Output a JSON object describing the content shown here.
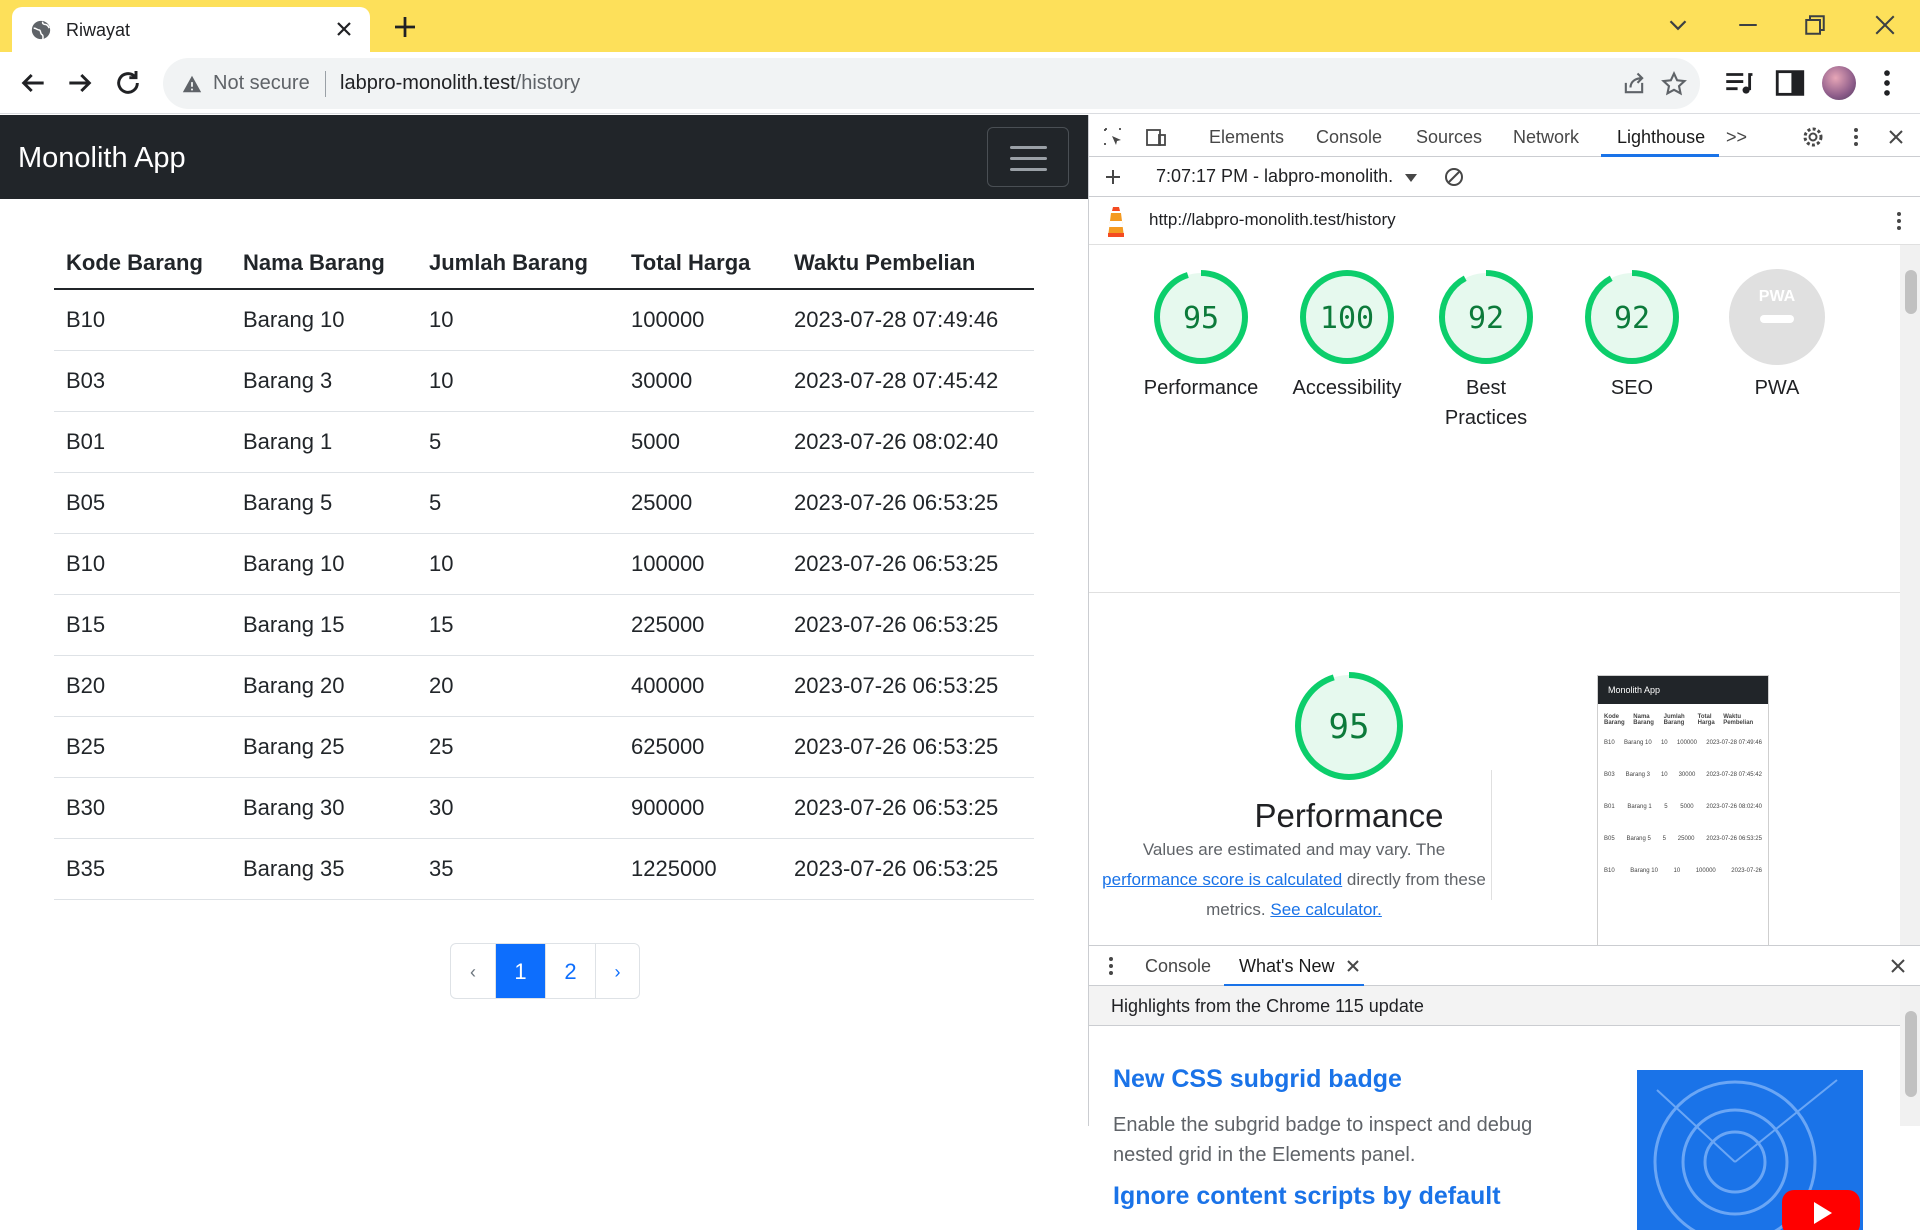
{
  "browser": {
    "tab_title": "Riwayat",
    "security_label": "Not secure",
    "url_host": "labpro-monolith.test",
    "url_path": "/history"
  },
  "app": {
    "brand": "Monolith App",
    "table": {
      "headers": [
        "Kode Barang",
        "Nama Barang",
        "Jumlah Barang",
        "Total Harga",
        "Waktu Pembelian"
      ],
      "rows": [
        [
          "B10",
          "Barang 10",
          "10",
          "100000",
          "2023-07-28 07:49:46"
        ],
        [
          "B03",
          "Barang 3",
          "10",
          "30000",
          "2023-07-28 07:45:42"
        ],
        [
          "B01",
          "Barang 1",
          "5",
          "5000",
          "2023-07-26 08:02:40"
        ],
        [
          "B05",
          "Barang 5",
          "5",
          "25000",
          "2023-07-26 06:53:25"
        ],
        [
          "B10",
          "Barang 10",
          "10",
          "100000",
          "2023-07-26 06:53:25"
        ],
        [
          "B15",
          "Barang 15",
          "15",
          "225000",
          "2023-07-26 06:53:25"
        ],
        [
          "B20",
          "Barang 20",
          "20",
          "400000",
          "2023-07-26 06:53:25"
        ],
        [
          "B25",
          "Barang 25",
          "25",
          "625000",
          "2023-07-26 06:53:25"
        ],
        [
          "B30",
          "Barang 30",
          "30",
          "900000",
          "2023-07-26 06:53:25"
        ],
        [
          "B35",
          "Barang 35",
          "35",
          "1225000",
          "2023-07-26 06:53:25"
        ]
      ]
    },
    "pagination": {
      "prev": "‹",
      "pages": [
        "1",
        "2"
      ],
      "active": "1",
      "next": "›"
    }
  },
  "devtools": {
    "tabs": [
      "Elements",
      "Console",
      "Sources",
      "Network",
      "Lighthouse"
    ],
    "active_tab": "Lighthouse",
    "more_tabs": ">>",
    "report_selector": "7:07:17 PM - labpro-monolith.",
    "audited_url": "http://labpro-monolith.test/history",
    "scores": [
      {
        "label": "Performance",
        "score": 95
      },
      {
        "label": "Accessibility",
        "score": 100
      },
      {
        "label": "Best Practices",
        "score": 92
      },
      {
        "label": "SEO",
        "score": 92
      },
      {
        "label": "PWA",
        "score": null
      }
    ],
    "pwa_badge": "PWA",
    "performance": {
      "score": "95",
      "title": "Performance",
      "desc_1": "Values are estimated and may vary. The",
      "desc_link": "performance score is calculated",
      "desc_2": "directly from these",
      "desc_3": "metrics.",
      "calc_link": "See calculator."
    },
    "thumbnail": {
      "brand": "Monolith App",
      "headers": [
        "Kode Barang",
        "Nama Barang",
        "Jumlah Barang",
        "Total Harga",
        "Waktu Pembelian"
      ],
      "rows": [
        [
          "B10",
          "Barang 10",
          "10",
          "100000",
          "2023-07-28 07:49:46"
        ],
        [
          "B03",
          "Barang 3",
          "10",
          "30000",
          "2023-07-28 07:45:42"
        ],
        [
          "B01",
          "Barang 1",
          "5",
          "5000",
          "2023-07-26 08:02:40"
        ],
        [
          "B05",
          "Barang 5",
          "5",
          "25000",
          "2023-07-26 06:53:25"
        ],
        [
          "B10",
          "Barang 10",
          "10",
          "100000",
          "2023-07-26"
        ]
      ]
    },
    "drawer": {
      "tabs": [
        "Console",
        "What's New"
      ],
      "active_tab": "What's New",
      "header": "Highlights from the Chrome 115 update",
      "item1_title": "New CSS subgrid badge",
      "item1_desc": "Enable the subgrid badge to inspect and debug nested grid in the Elements panel.",
      "item2_title": "Ignore content scripts by default"
    }
  },
  "colors": {
    "pass": "#0cce6b",
    "pass_bg": "#e6f9ee",
    "pass_text": "#0c7a3a",
    "link": "#1a73e8",
    "primary": "#0d6efd",
    "titlebar": "#fde05a"
  }
}
